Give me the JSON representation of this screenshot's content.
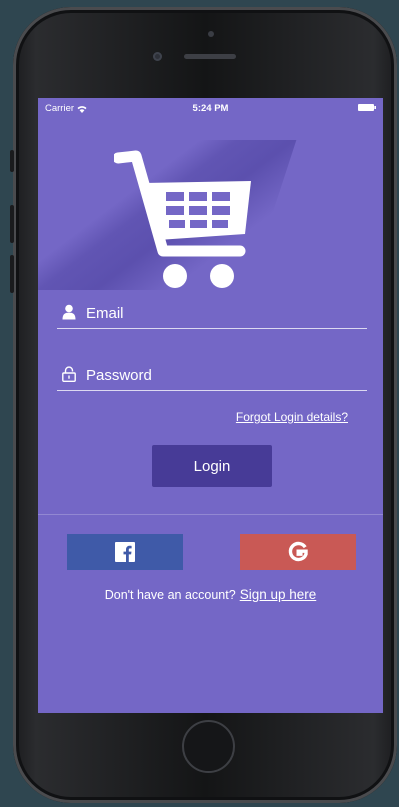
{
  "status_bar": {
    "carrier": "Carrier",
    "time": "5:24 PM",
    "icons": [
      "wifi-icon",
      "battery-icon"
    ]
  },
  "logo": {
    "icon": "shopping-cart-icon"
  },
  "login_form": {
    "email": {
      "placeholder": "Email",
      "value": "",
      "icon": "user-icon"
    },
    "password": {
      "placeholder": "Password",
      "value": "",
      "icon": "lock-icon"
    },
    "forgot_link": "Forgot Login details?",
    "login_label": "Login"
  },
  "social": {
    "facebook_icon": "facebook-icon",
    "google_icon": "google-icon"
  },
  "signup": {
    "prompt": "Don't have an account?",
    "link": "Sign up here"
  },
  "colors": {
    "screen_background": "#7467c6",
    "login_button": "#473b97",
    "facebook": "#3f5aa8",
    "google": "#c95955"
  }
}
